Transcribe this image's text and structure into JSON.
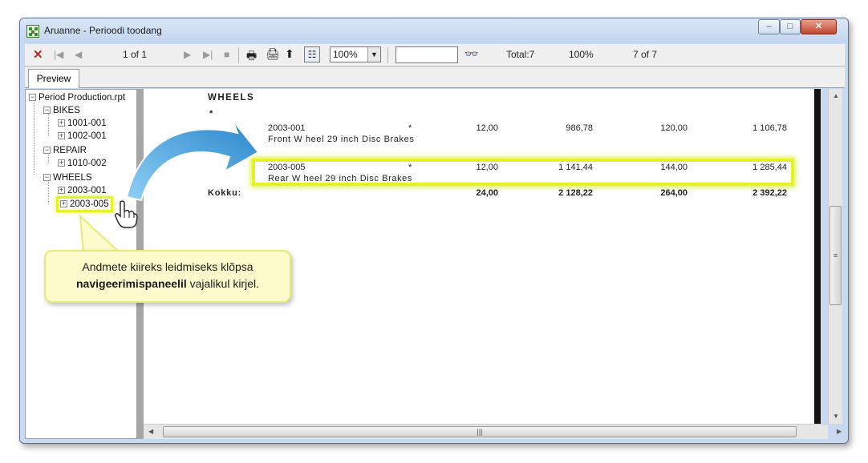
{
  "window": {
    "title": "Aruanne - Perioodi toodang"
  },
  "toolbar": {
    "page_label": "1 of 1",
    "zoom_value": "100%",
    "search_value": "",
    "total_label": "Total:7",
    "percent_label": "100%",
    "count_label": "7 of 7"
  },
  "tabs": {
    "preview_label": "Preview"
  },
  "tree": {
    "root": "Period Production.rpt",
    "groups": [
      {
        "label": "BIKES",
        "items": [
          "1001-001",
          "1002-001"
        ]
      },
      {
        "label": "REPAIR",
        "items": [
          "1010-002"
        ]
      },
      {
        "label": "WHEELS",
        "items": [
          "2003-001",
          "2003-005"
        ]
      }
    ]
  },
  "report": {
    "group_title": "WHEELS",
    "star": "*",
    "rows": [
      {
        "code": "2003-001",
        "mark": "*",
        "description": "Front W heel 29 inch Disc Brakes",
        "qty": "12,00",
        "amount": "986,78",
        "tax": "120,00",
        "total": "1 106,78"
      },
      {
        "code": "2003-005",
        "mark": "*",
        "description": "Rear W heel 29 inch Disc Brakes",
        "qty": "12,00",
        "amount": "1 141,44",
        "tax": "144,00",
        "total": "1 285,44"
      }
    ],
    "total_row": {
      "label": "Kokku:",
      "qty": "24,00",
      "amount": "2 128,22",
      "tax": "264,00",
      "total": "2 392,22"
    }
  },
  "callout": {
    "line1": "Andmete kiireks leidmiseks klõpsa",
    "line2_bold": "navigeerimispaneelil",
    "line2_rest": " vajalikul kirjel."
  },
  "colors": {
    "highlight": "#e6f226",
    "arrow": "#3a9ad9",
    "callout_bg": "#fefccd"
  }
}
